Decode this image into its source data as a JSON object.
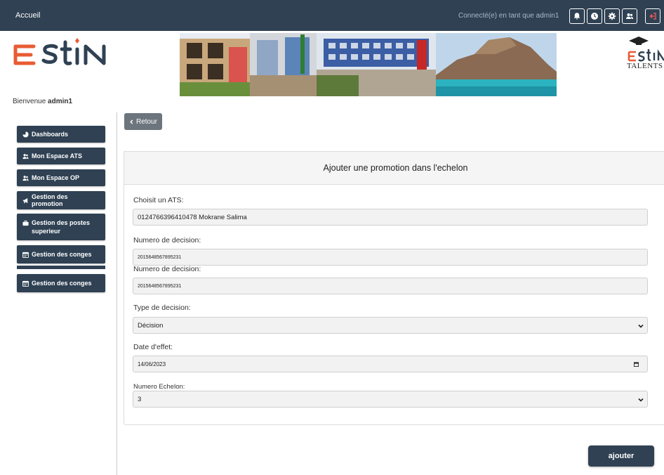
{
  "topbar": {
    "home_label": "Accueil",
    "connected_text": "Connecté(e) en tant que admin1",
    "bg_color": "#2f4153",
    "icons": [
      "bell-icon",
      "clock-icon",
      "gear-icon",
      "users-icon",
      "logout-icon"
    ]
  },
  "header": {
    "logo_text": "ESTIN",
    "logo2_text": "TALENTS",
    "welcome_prefix": "Bienvenue ",
    "welcome_user": "admin1"
  },
  "sidebar": {
    "items": [
      {
        "label": "Dashboards",
        "icon": "chart-pie-icon"
      },
      {
        "label": "Mon Espace ATS",
        "icon": "users-icon"
      },
      {
        "label": "Mon Espace OP",
        "icon": "users-icon"
      },
      {
        "label": "Gestion des promotion",
        "icon": "bullhorn-icon"
      },
      {
        "label": "Gestion des postes superieur",
        "icon": "briefcase-icon"
      },
      {
        "label": "Gestion des conges",
        "icon": "calendar-icon"
      },
      {
        "label": "Gestion des conges",
        "icon": "calendar-icon"
      }
    ]
  },
  "main": {
    "back_label": "Retour",
    "card_title": "Ajouter une promotion dans l'echelon",
    "fields": {
      "ats_label": "Choisit un ATS:",
      "ats_value": "0124766396410478 Mokrane Salima",
      "decision1_label": "Numero de decision:",
      "decision1_value": "2015648567895231",
      "decision2_label": "Numero de decision:",
      "decision2_value": "2015648567895231",
      "type_label": "Type de decision:",
      "type_value": "Décision",
      "date_label": "Date d'effet:",
      "date_value": "14/06/2023",
      "echelon_label": "Numero Echelon:",
      "echelon_value": "3"
    },
    "submit_label": "ajouter"
  }
}
